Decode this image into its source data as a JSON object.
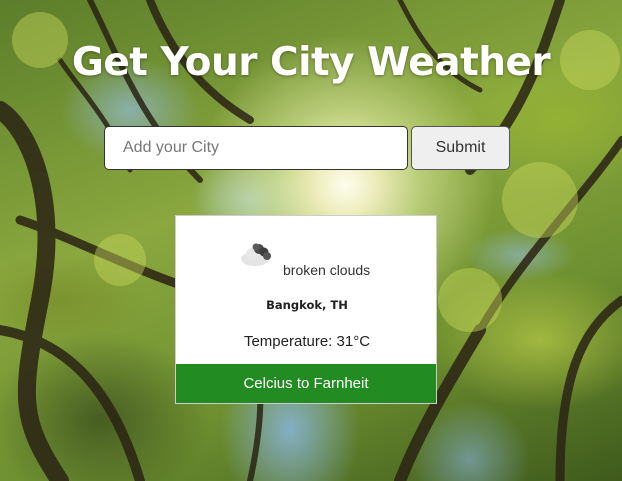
{
  "header": {
    "title": "Get Your City Weather"
  },
  "search": {
    "placeholder": "Add your City",
    "value": "",
    "submit_label": "Submit"
  },
  "weather": {
    "icon": "broken-clouds-icon",
    "condition": "broken clouds",
    "city": "Bangkok, TH",
    "temperature_label": "Temperature:",
    "temperature_value": "31°C",
    "convert_label": "Celcius to Farnheit"
  },
  "colors": {
    "accent": "#228B22",
    "card_bg": "#ffffff",
    "title": "#ffffff"
  }
}
